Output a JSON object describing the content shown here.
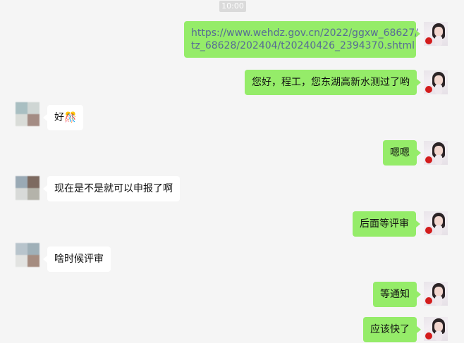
{
  "timestamp": "10:00",
  "messages": [
    {
      "sender": "me",
      "text": "https://www.wehdz.gov.cn/2022/ggxw_68627/",
      "text2": "tz_68628/202404/t20240426_2394370.shtml",
      "type": "link"
    },
    {
      "sender": "me",
      "text": "您好，程工，您东湖高新水测过了哟"
    },
    {
      "sender": "them",
      "text": "好",
      "emoji": "🎊"
    },
    {
      "sender": "me",
      "text": "嗯嗯"
    },
    {
      "sender": "them",
      "text": "现在是不是就可以申报了啊"
    },
    {
      "sender": "me",
      "text": "后面等评审"
    },
    {
      "sender": "them",
      "text": "啥时候评审"
    },
    {
      "sender": "me",
      "text": "等通知"
    },
    {
      "sender": "me",
      "text": "应该快了"
    }
  ],
  "colors": {
    "background": "#f5f5f5",
    "my_bubble": "#95ec69",
    "their_bubble": "#ffffff",
    "link": "#576b95"
  },
  "icons": {
    "my_avatar": "woman-portrait-avatar",
    "their_avatar": "blurred-mosaic-avatar",
    "emoji": "firecracker-emoji"
  }
}
